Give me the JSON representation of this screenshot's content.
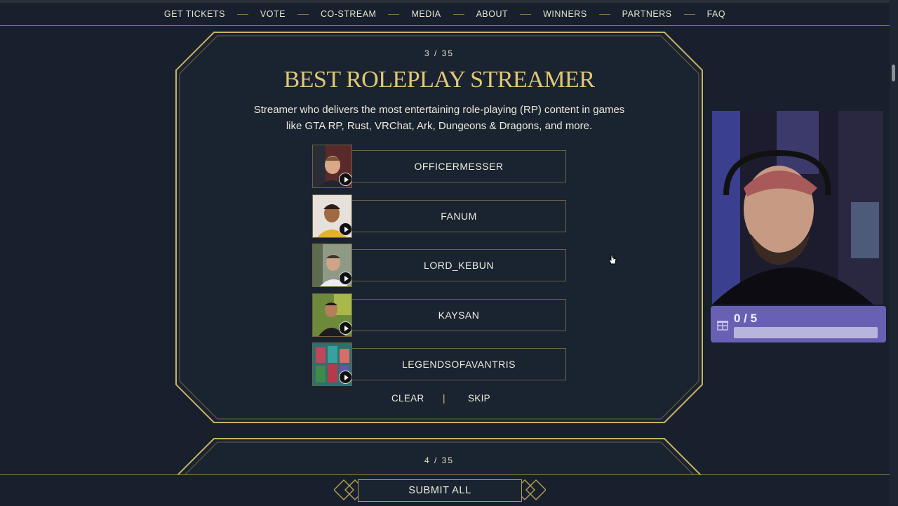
{
  "nav": {
    "items": [
      "GET TICKETS",
      "VOTE",
      "CO-STREAM",
      "MEDIA",
      "ABOUT",
      "WINNERS",
      "PARTNERS",
      "FAQ"
    ]
  },
  "category": {
    "counter": "3 / 35",
    "title": "BEST ROLEPLAY STREAMER",
    "description": "Streamer who delivers the most entertaining role-playing (RP) content in games like GTA RP, Rust, VRChat, Ark, Dungeons & Dragons, and more.",
    "nominees": [
      {
        "name": "OFFICERMESSER"
      },
      {
        "name": "FANUM"
      },
      {
        "name": "LORD_KEBUN"
      },
      {
        "name": "KAYSAN"
      },
      {
        "name": "LEGENDSOFAVANTRIS"
      }
    ],
    "clear_label": "CLEAR",
    "divider": "|",
    "skip_label": "SKIP"
  },
  "next_category": {
    "counter": "4 / 35"
  },
  "submit_label": "SUBMIT ALL",
  "goal_widget": {
    "text": "0 / 5",
    "progress": 0
  },
  "colors": {
    "background": "#17202c",
    "gold": "#e0c872",
    "gold_border": "#b39b52",
    "goal_purple": "#6861b3"
  },
  "icons": [
    "play-icon",
    "gift-icon",
    "hand-cursor-icon",
    "diamond-icon"
  ]
}
